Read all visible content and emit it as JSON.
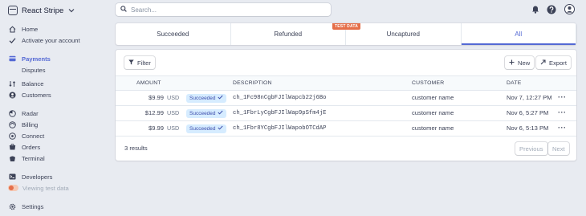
{
  "brand": {
    "name": "React Stripe"
  },
  "search": {
    "placeholder": "Search..."
  },
  "nav": {
    "home": "Home",
    "activate": "Activate your account",
    "payments": "Payments",
    "disputes": "Disputes",
    "balance": "Balance",
    "customers": "Customers",
    "radar": "Radar",
    "billing": "Billing",
    "connect": "Connect",
    "orders": "Orders",
    "terminal": "Terminal",
    "developers": "Developers",
    "test_data": "Viewing test data",
    "settings": "Settings"
  },
  "tabs": [
    {
      "label": "Succeeded",
      "active": false
    },
    {
      "label": "Refunded",
      "active": false
    },
    {
      "label": "Uncaptured",
      "active": false
    },
    {
      "label": "All",
      "active": true
    }
  ],
  "test_badge": "TEST DATA",
  "toolbar": {
    "filter": "Filter",
    "new": "New",
    "export": "Export"
  },
  "table": {
    "headers": {
      "amount": "AMOUNT",
      "description": "DESCRIPTION",
      "customer": "CUSTOMER",
      "date": "DATE"
    },
    "rows": [
      {
        "amount": "$9.99",
        "currency": "USD",
        "status": "Succeeded",
        "description": "ch_1Fc98nCgbFJIlWapcb22j6Bo",
        "customer": "customer name",
        "date": "Nov 7, 12:27 PM"
      },
      {
        "amount": "$12.99",
        "currency": "USD",
        "status": "Succeeded",
        "description": "ch_1FbrLyCgbFJIlWap9pSfm4jE",
        "customer": "customer name",
        "date": "Nov 6, 5:27 PM"
      },
      {
        "amount": "$9.99",
        "currency": "USD",
        "status": "Succeeded",
        "description": "ch_1Fbr8YCgbFJIlWapobOTCdAP",
        "customer": "customer name",
        "date": "Nov 6, 5:13 PM"
      }
    ]
  },
  "footer": {
    "results": "3 results",
    "previous": "Previous",
    "next": "Next"
  },
  "colors": {
    "accent": "#5469d4",
    "test": "#e56f4a",
    "badge_bg": "#d6ecff"
  }
}
